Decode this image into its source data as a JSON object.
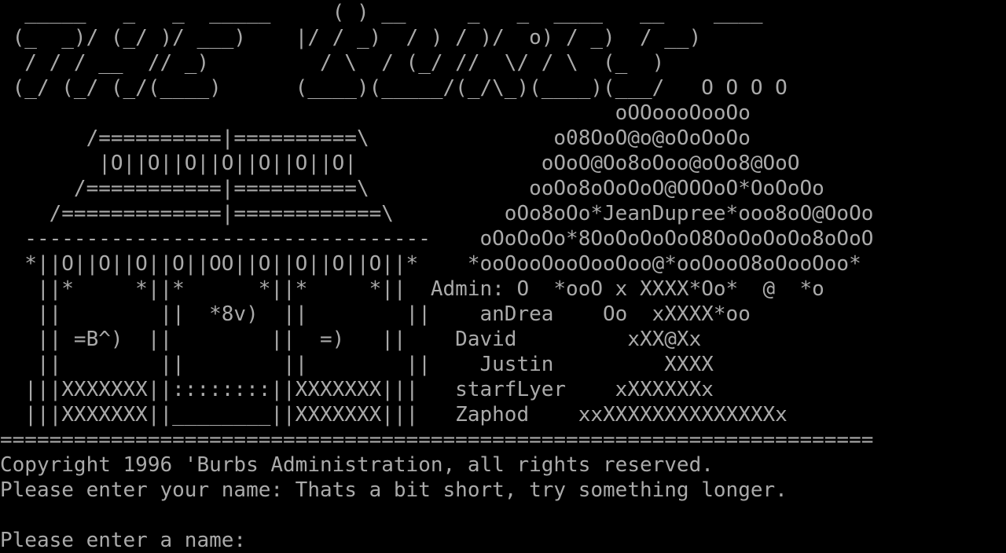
{
  "screen": {
    "foreground": "#aaaaaa",
    "background": "#000000",
    "lines": [
      "  _____   _   _  _____     ( ) __     _   _  ____   __    ____",
      " (_  _)/ (_/ )/ ___)    |/ / _)  / ) / )/  o) / _)  / __)",
      "  / / / __  // _)         / \\  / (_/ //  \\/ / \\  (_  )",
      " (_/ (_/ (_/(____)      (____)(_____/(_/\\_)(____)(___/   O O O O",
      "                                                  oOOoooOooOo",
      "       /==========|==========\\               o08OoO@o@oOoOoOo",
      "        |O||O||O||O||O||O||O|               oOoO@Oo8oOoo@oOo8@OoO",
      "      /===========|==========\\             ooOo8oOoOoO@OOOoO*OoOoOo",
      "    /=============|============\\         oOo8oOo*JeanDupree*ooo8oO@OoOo",
      "  ---------------------------------    oOoOoOo*8OoOoOoOoO8OoOoOoOo8oOoO",
      "  *||O||O||O||O||OO||O||O||O||O||*    *ooOooOooOooOoo@*ooOooO8oOooOoo*",
      "   ||*     *||*      *||*     *||  Admin: O  *ooO x XXXX*Oo*  @  *o",
      "   ||        ||  *8v)  ||        ||    anDrea    Oo  xXXXX*oo",
      "   || =B^)  ||        ||  =)   ||    David         xXX@Xx",
      "   ||        ||        ||        ||    Justin         XXXX",
      "  |||XXXXXXX||::::::::||XXXXXXX|||   starfLyer    xXXXXXXx",
      "  |||XXXXXXX||________||XXXXXXX|||   Zaphod    xxXXXXXXXXXXXXXXx",
      "=======================================================================",
      "Copyright 1996 'Burbs Administration, all rights reserved.",
      "Please enter your name: Thats a bit short, try something longer.",
      "",
      "Please enter a name: "
    ]
  }
}
